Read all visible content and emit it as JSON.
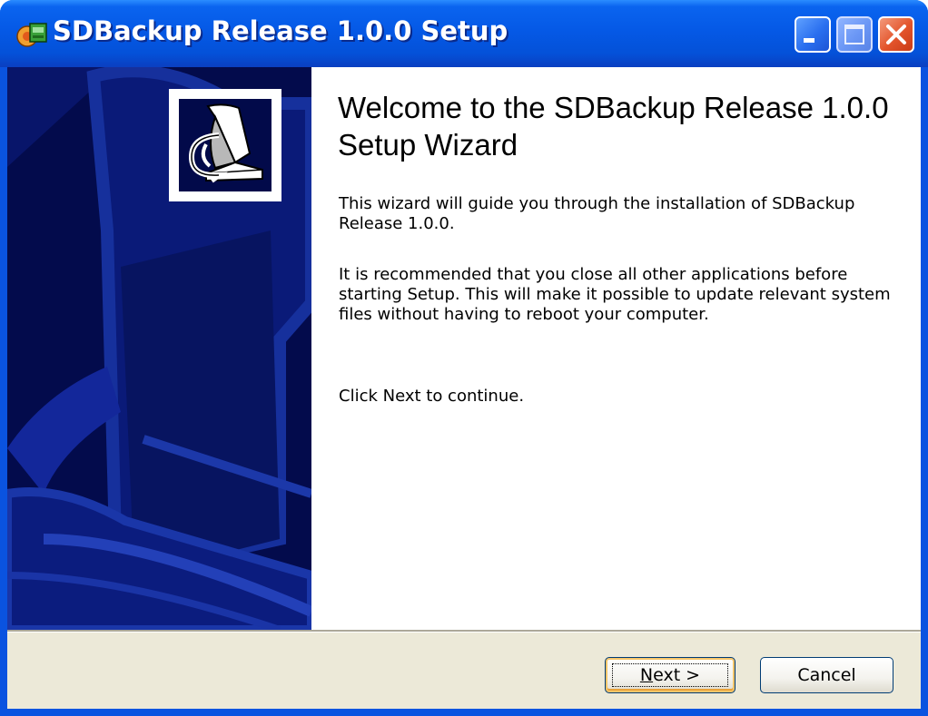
{
  "window": {
    "title": "SDBackup Release 1.0.0 Setup"
  },
  "content": {
    "heading": "Welcome to the SDBackup Release 1.0.0 Setup Wizard",
    "paragraphs": [
      "This wizard will guide you through the installation of SDBackup Release 1.0.0.",
      "It is recommended that you close all other applications before starting Setup. This will make it possible to update relevant system files without having to reboot your computer.",
      "Click Next to continue."
    ]
  },
  "buttons": {
    "next_mnemonic": "N",
    "next_rest": "ext >",
    "cancel": "Cancel"
  },
  "colors": {
    "titlebar": "#0559e6",
    "banner": "#020a4a",
    "footer": "#ece9d8",
    "close_button": "#e3542b"
  },
  "icons": {
    "app": "installer-box-icon",
    "minimize": "minimize-icon",
    "maximize": "maximize-icon",
    "close": "close-icon",
    "hero": "computer-backup-icon"
  }
}
